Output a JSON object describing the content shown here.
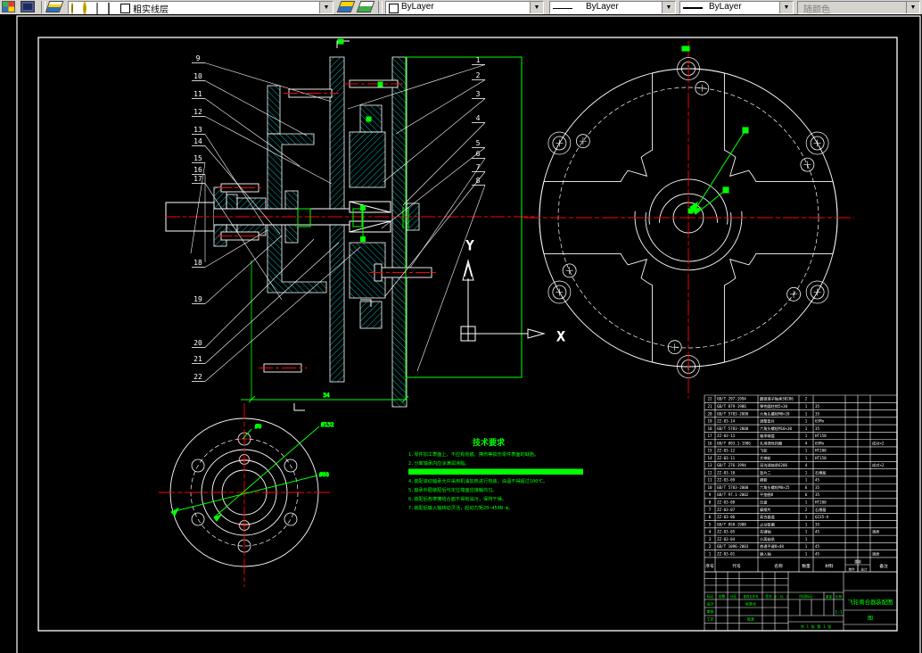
{
  "toolbar": {
    "layer_combo": {
      "value": "粗实线层"
    },
    "color_combo": {
      "value": "ByLayer"
    },
    "linetype_combo": {
      "value": "ByLayer"
    },
    "lineweight_combo": {
      "value": "ByLayer"
    },
    "plotstyle_combo": {
      "value": "随颜色"
    },
    "dropdown_glyph": "▼"
  },
  "drawing": {
    "ucs": {
      "x_label": "X",
      "y_label": "Y"
    },
    "balloons": {
      "right": [
        "1",
        "2",
        "3",
        "4",
        "5",
        "6",
        "7",
        "8"
      ],
      "left": [
        "9",
        "10",
        "11",
        "12",
        "13",
        "14",
        "15",
        "16",
        "17"
      ],
      "bottom": [
        "18",
        "19",
        "20",
        "21",
        "22"
      ]
    },
    "dims": {
      "overall": "34",
      "hole": "Ø9",
      "bolt_circle": "Ø132",
      "hub": "Ø68"
    }
  },
  "tech_requirements": {
    "title": "技术要求",
    "lines": [
      "1.零件加工表面上，不应有划痕、擦伤等损伤零件表面的缺陷。",
      "2.分离轴承内应涂满润滑脂。",
      "",
      "4.装配滚动轴承允许采用机油加热进行热装，油温不得超过100℃。",
      "5.轴承外圈装配后与定位端面应接触均匀。",
      "6.装配后各摩擦结合面不得有油污，保持干燥。",
      "7.装配后输入轴转动灵活，起动力矩20~450N·m。"
    ]
  },
  "bom": {
    "headers": [
      "序号",
      "代号",
      "名称",
      "数量",
      "材料",
      "单件",
      "总计",
      "备注"
    ],
    "weight_header": "重量",
    "rows": [
      [
        "22",
        "GB/T 297-1994",
        "圆锥滚子轴承30206",
        "2",
        "",
        "",
        ""
      ],
      [
        "21",
        "GB/T 879-1986",
        "弹性圆柱销5×30",
        "1",
        "35",
        "",
        ""
      ],
      [
        "20",
        "GB/T 5783-2000",
        "六角头螺栓M8×20",
        "1",
        "35",
        "",
        ""
      ],
      [
        "19",
        "ZZ-03-14",
        "调整垫片",
        "1",
        "65Mn",
        "",
        ""
      ],
      [
        "18",
        "GB/T 5783-2000",
        "六角头螺栓M10×30",
        "1",
        "35",
        "",
        ""
      ],
      [
        "17",
        "ZZ-03-13",
        "轴承端盖",
        "1",
        "HT150",
        "",
        ""
      ],
      [
        "16",
        "GB/T 893.1-1986",
        "孔用弹性挡圈",
        "4",
        "65Mn",
        "",
        "成对×2"
      ],
      [
        "15",
        "ZZ-03-12",
        "飞轮",
        "1",
        "HT200",
        "",
        ""
      ],
      [
        "14",
        "ZZ-03-11",
        "大带轮",
        "1",
        "HT150",
        "",
        ""
      ],
      [
        "13",
        "GB/T 276-1994",
        "深沟球轴承6206",
        "4",
        "",
        "",
        "成对×2"
      ],
      [
        "12",
        "ZZ-03-10",
        "垫片二",
        "1",
        "石棉板",
        "",
        ""
      ],
      [
        "11",
        "ZZ-03-09",
        "隔套",
        "1",
        "45",
        "",
        ""
      ],
      [
        "10",
        "GB/T 5783-2000",
        "六角头螺栓M8×25",
        "6",
        "35",
        "",
        ""
      ],
      [
        "9",
        "GB/T 97.1-2002",
        "平垫圈8",
        "6",
        "35",
        "",
        ""
      ],
      [
        "8",
        "ZZ-03-08",
        "压盘",
        "1",
        "HT200",
        "",
        ""
      ],
      [
        "7",
        "ZZ-03-07",
        "摩擦片",
        "2",
        "石棉基",
        "",
        ""
      ],
      [
        "6",
        "ZZ-03-06",
        "离合器盖",
        "1",
        "Q235-A",
        "",
        ""
      ],
      [
        "5",
        "GB/T 858-1988",
        "止动垫圈",
        "1",
        "35",
        "",
        ""
      ],
      [
        "4",
        "ZZ-03-05",
        "花键轴",
        "1",
        "45",
        "",
        "调质"
      ],
      [
        "3",
        "ZZ-03-04",
        "分离轴承",
        "1",
        "",
        "",
        ""
      ],
      [
        "2",
        "GB/T 1096-2003",
        "普通平键8×40",
        "1",
        "45",
        "",
        ""
      ],
      [
        "1",
        "ZZ-03-01",
        "输入轴",
        "1",
        "45",
        "",
        "调质"
      ]
    ]
  },
  "title_block": {
    "labels": {
      "mark": "标记",
      "count": "处数",
      "zone": "分区",
      "change_doc": "更改文件号",
      "sign": "签名",
      "date": "年、月、日",
      "design": "设计",
      "standard": "标准化",
      "audit": "审核",
      "process": "工艺",
      "approve": "批准",
      "stage_mark": "阶段标记",
      "weight": "重量",
      "ratio": "比例",
      "sheet": "共 1 张 第 1 张"
    },
    "scale_value": "1:1",
    "title": "飞轮离合器装配图",
    "subtitle": "图"
  },
  "colors": {
    "background": "#000000",
    "line": "#ffffff",
    "hatch": "#00dcdc",
    "centerline": "#ff0000",
    "selected": "#00ff00",
    "toolbar_bg": "#d6d3ce"
  }
}
